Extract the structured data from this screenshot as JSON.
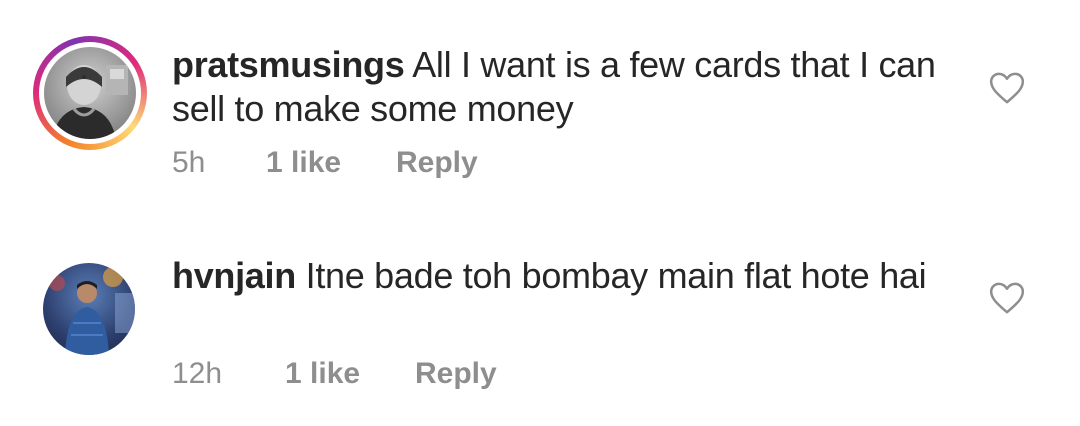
{
  "comments": [
    {
      "username": "pratsmusings",
      "text": "All I want is a few cards that I can sell to make some money",
      "time": "5h",
      "likes": "1 like",
      "reply": "Reply",
      "has_story_ring": true,
      "liked": false
    },
    {
      "username": "hvnjain",
      "text": "Itne bade toh bombay main flat hote hai",
      "time": "12h",
      "likes": "1 like",
      "reply": "Reply",
      "has_story_ring": false,
      "liked": false
    }
  ],
  "icons": {
    "like": "heart-outline-icon"
  },
  "colors": {
    "text": "#262626",
    "meta": "#8e8e8e",
    "heart_outline": "#8e8e8e"
  }
}
